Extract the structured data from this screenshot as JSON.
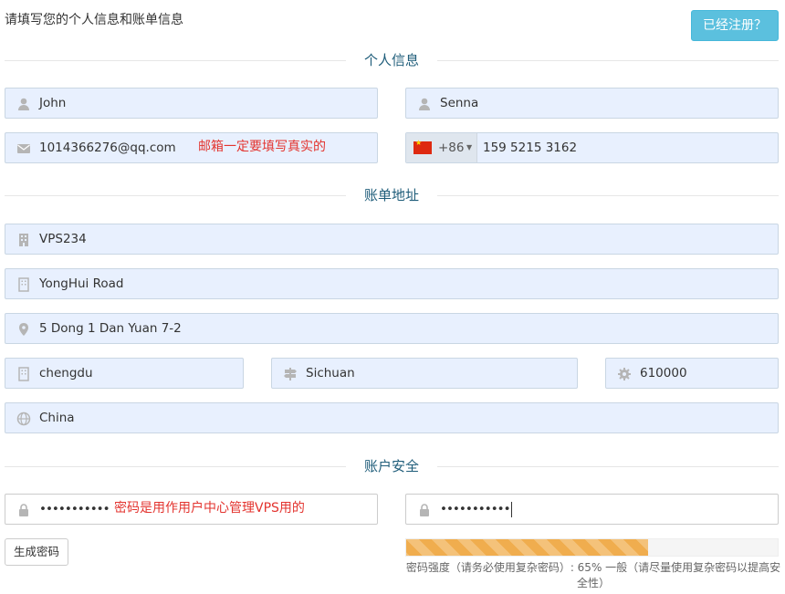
{
  "header": {
    "intro": "请填写您的个人信息和账单信息",
    "login_button": "已经注册？"
  },
  "sections": {
    "personal": "个人信息",
    "billing": "账单地址",
    "security": "账户安全"
  },
  "personal": {
    "first_name": "John",
    "last_name": "Senna",
    "email": "1014366276@qq.com",
    "email_note": "邮箱一定要填写真实的",
    "phone_dial": "+86",
    "phone": "159 5215 3162"
  },
  "billing": {
    "company": "VPS234",
    "address1": "YongHui Road",
    "address2": "5 Dong 1 Dan Yuan 7-2",
    "city": "chengdu",
    "state": "Sichuan",
    "postcode": "610000",
    "country": "China"
  },
  "security": {
    "password": "•••••••••••",
    "password_note": "密码是用作用户中心管理VPS用的",
    "password_confirm": "•••••••••••",
    "generate_button": "生成密码",
    "strength_percent": 65,
    "strength_text": "密码强度（请务必使用复杂密码）: 65% 一般（请尽量使用复杂密码以提高安全性）"
  },
  "colors": {
    "accent": "#5bc0de",
    "section_title": "#1f5d7a",
    "note": "#e3342f",
    "meter": "#f0ad4e",
    "field_bg": "#e8f0fe"
  },
  "icons": [
    "user-icon",
    "envelope-icon",
    "building-icon",
    "map-marker-icon",
    "signpost-icon",
    "gear-icon",
    "globe-icon",
    "lock-icon",
    "china-flag-icon"
  ]
}
